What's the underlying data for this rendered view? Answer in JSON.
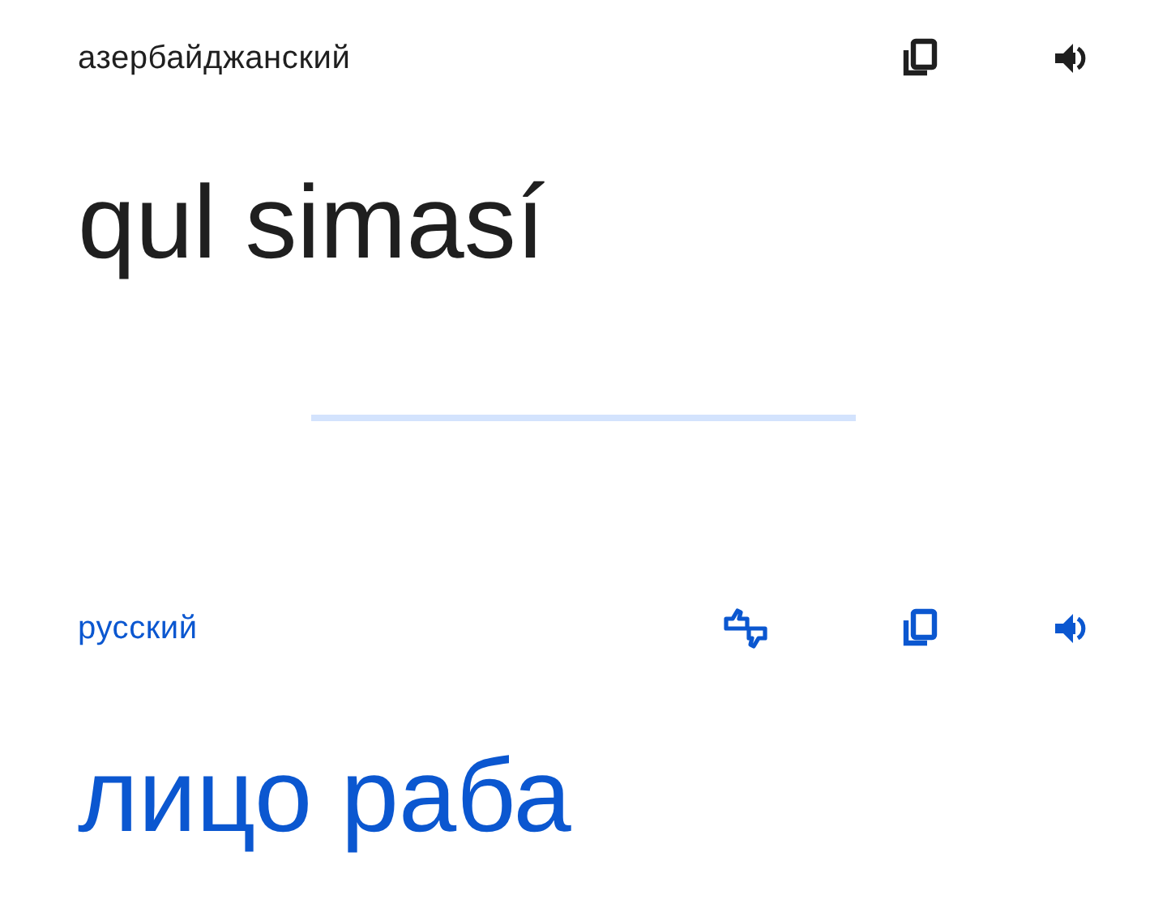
{
  "source": {
    "language": "азербайджанский",
    "text": "qul simasí"
  },
  "target": {
    "language": "русский",
    "text": "лицо раба"
  }
}
